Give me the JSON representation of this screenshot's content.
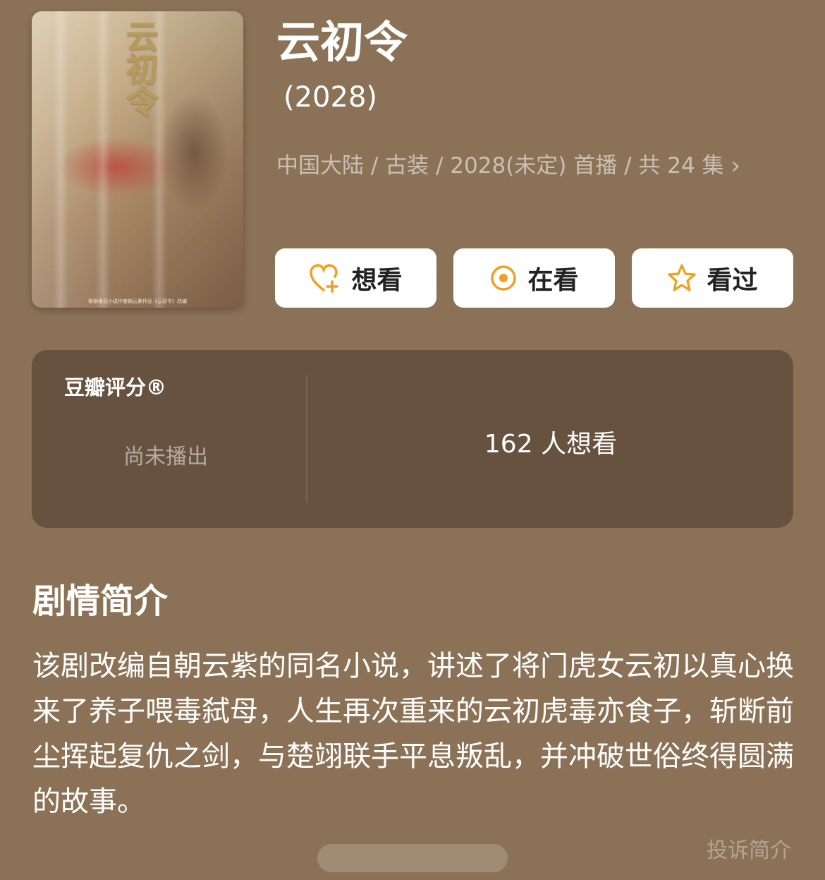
{
  "title": "云初令",
  "year": "(2028)",
  "meta": "中国大陆 / 古装 / 2028(未定) 首播 / 共 24 集",
  "poster": {
    "title": "云初令",
    "caption": "根据番茄小说作者朝云紫作品《云初令》改编"
  },
  "actions": {
    "want_label": "想看",
    "watching_label": "在看",
    "watched_label": "看过"
  },
  "rating": {
    "label": "豆瓣评分®",
    "status": "尚未播出",
    "want_count": "162 人想看"
  },
  "synopsis_title": "剧情简介",
  "synopsis": "该剧改编自朝云紫的同名小说，讲述了将门虎女云初以真心换来了养子喂毒弑母，人生再次重来的云初虎毒亦食子，斩断前尘挥起复仇之剑，与楚翊联手平息叛乱，并冲破世俗终得圆满的故事。",
  "report_label": "投诉简介",
  "colors": {
    "background": "#8b7257",
    "card": "#66523f",
    "accent": "#f0a020"
  }
}
